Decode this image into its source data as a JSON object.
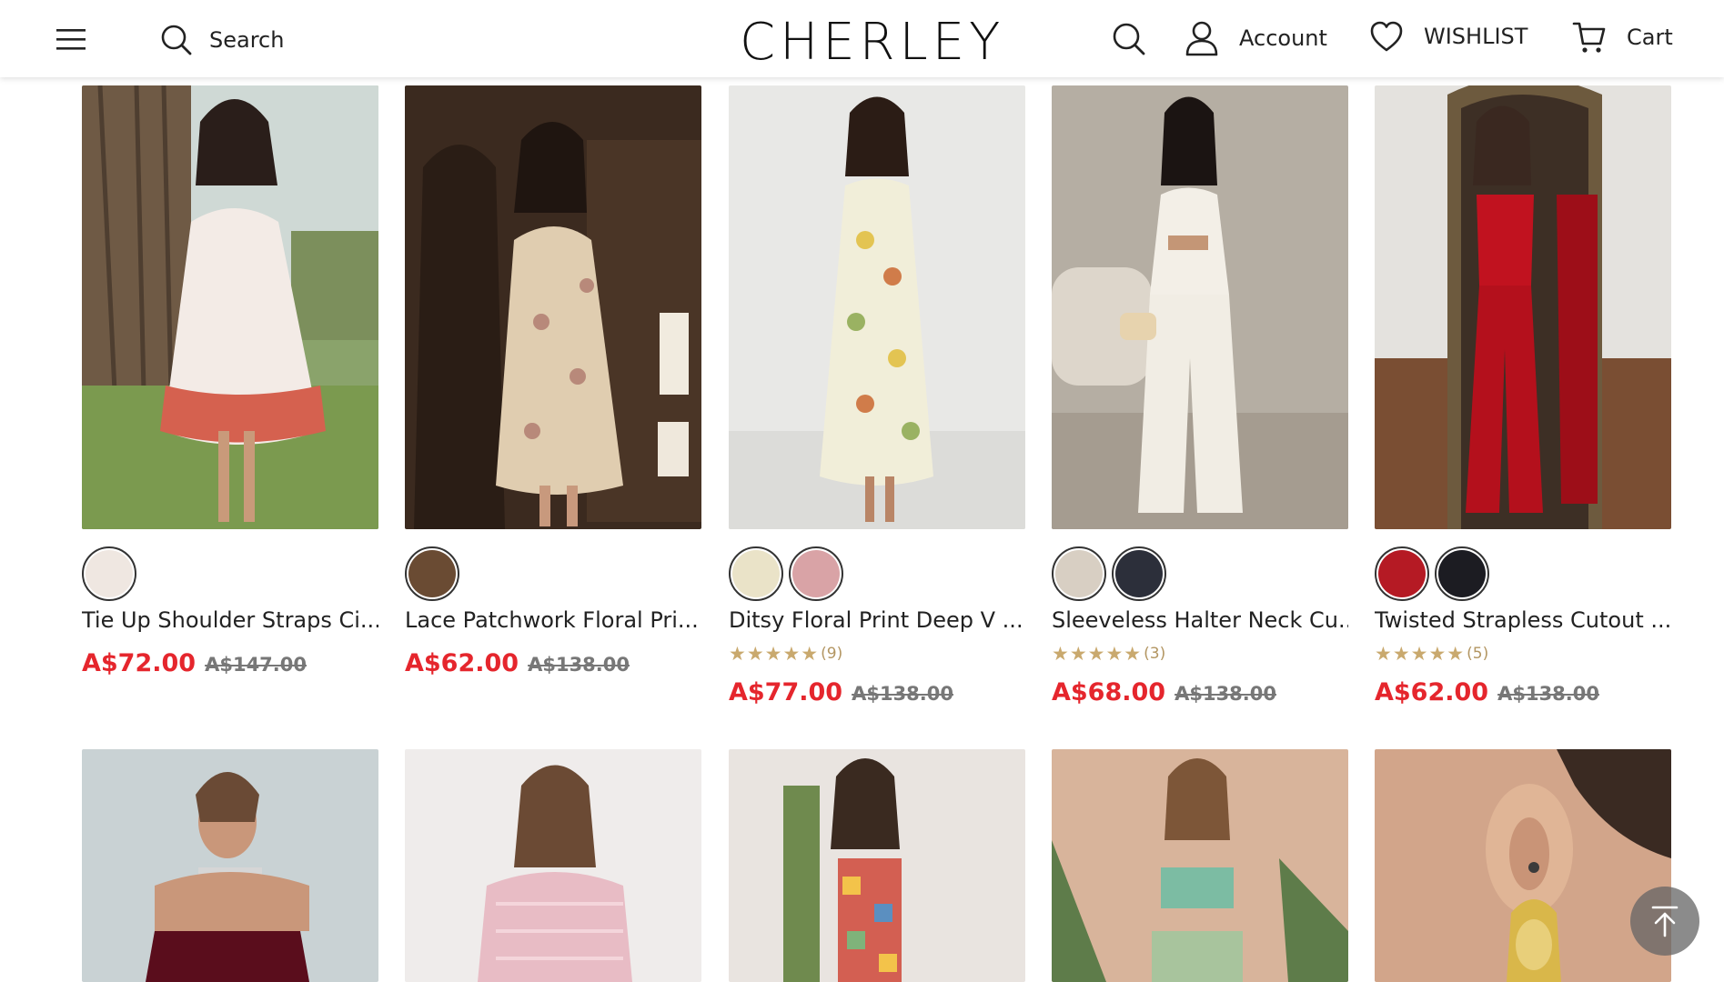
{
  "header": {
    "search_label": "Search",
    "logo": "CHERLEY",
    "account_label": "Account",
    "wishlist_label": "WISHLIST",
    "cart_label": "Cart"
  },
  "products": [
    {
      "title": "Tie Up Shoulder Straps Ci...",
      "sale_price": "A$72.00",
      "original_price": "A$147.00",
      "rating_count": "",
      "swatches": [
        "#efe7e1"
      ]
    },
    {
      "title": "Lace Patchwork Floral Pri...",
      "sale_price": "A$62.00",
      "original_price": "A$138.00",
      "rating_count": "",
      "swatches": [
        "#6a4b33"
      ]
    },
    {
      "title": "Ditsy Floral Print Deep V ...",
      "sale_price": "A$77.00",
      "original_price": "A$138.00",
      "rating_count": "(9)",
      "stars": "★★★★★",
      "swatches": [
        "#eae3c8",
        "#d9a3a6"
      ]
    },
    {
      "title": "Sleeveless Halter Neck Cu...",
      "sale_price": "A$68.00",
      "original_price": "A$138.00",
      "rating_count": "(3)",
      "stars": "★★★★★",
      "swatches": [
        "#d8cfc3",
        "#2c2f3a"
      ]
    },
    {
      "title": "Twisted Strapless Cutout ...",
      "sale_price": "A$62.00",
      "original_price": "A$138.00",
      "rating_count": "(5)",
      "stars": "★★★★★",
      "swatches": [
        "#b51a24",
        "#1c1c22"
      ]
    }
  ],
  "colors": {
    "sale": "#e5262d",
    "star": "#c9a96e"
  },
  "icons": [
    "menu-icon",
    "search-icon",
    "user-icon",
    "heart-icon",
    "cart-icon",
    "arrow-up-icon"
  ]
}
